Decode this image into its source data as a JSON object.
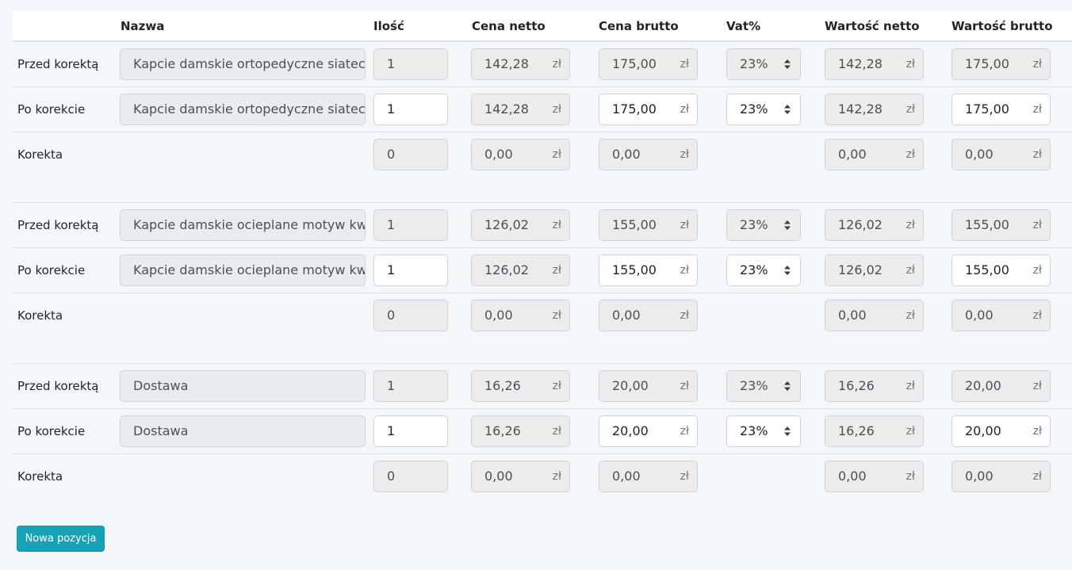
{
  "headers": {
    "name": "Nazwa",
    "qty": "Ilość",
    "net_price": "Cena netto",
    "gross_price": "Cena brutto",
    "vat": "Vat%",
    "net_value": "Wartość netto",
    "gross_value": "Wartość brutto"
  },
  "currency": "zł",
  "row_labels": {
    "before": "Przed korektą",
    "after": "Po korekcie",
    "diff": "Korekta"
  },
  "items": [
    {
      "before": {
        "name": "Kapcie damskie ortopedyczne siateczka",
        "qty": "1",
        "net_price": "142,28",
        "gross_price": "175,00",
        "vat": "23%",
        "net_value": "142,28",
        "gross_value": "175,00"
      },
      "after": {
        "name": "Kapcie damskie ortopedyczne siateczka",
        "qty": "1",
        "net_price": "142,28",
        "gross_price": "175,00",
        "vat": "23%",
        "net_value": "142,28",
        "gross_value": "175,00"
      },
      "diff": {
        "qty": "0",
        "net_price": "0,00",
        "gross_price": "0,00",
        "net_value": "0,00",
        "gross_value": "0,00"
      }
    },
    {
      "before": {
        "name": "Kapcie damskie ocieplane motyw kwiatowy",
        "qty": "1",
        "net_price": "126,02",
        "gross_price": "155,00",
        "vat": "23%",
        "net_value": "126,02",
        "gross_value": "155,00"
      },
      "after": {
        "name": "Kapcie damskie ocieplane motyw kwiatowy",
        "qty": "1",
        "net_price": "126,02",
        "gross_price": "155,00",
        "vat": "23%",
        "net_value": "126,02",
        "gross_value": "155,00"
      },
      "diff": {
        "qty": "0",
        "net_price": "0,00",
        "gross_price": "0,00",
        "net_value": "0,00",
        "gross_value": "0,00"
      }
    },
    {
      "before": {
        "name": "Dostawa",
        "qty": "1",
        "net_price": "16,26",
        "gross_price": "20,00",
        "vat": "23%",
        "net_value": "16,26",
        "gross_value": "20,00"
      },
      "after": {
        "name": "Dostawa",
        "qty": "1",
        "net_price": "16,26",
        "gross_price": "20,00",
        "vat": "23%",
        "net_value": "16,26",
        "gross_value": "20,00"
      },
      "diff": {
        "qty": "0",
        "net_price": "0,00",
        "gross_price": "0,00",
        "net_value": "0,00",
        "gross_value": "0,00"
      }
    }
  ],
  "add_button_label": "Nowa pozycja"
}
